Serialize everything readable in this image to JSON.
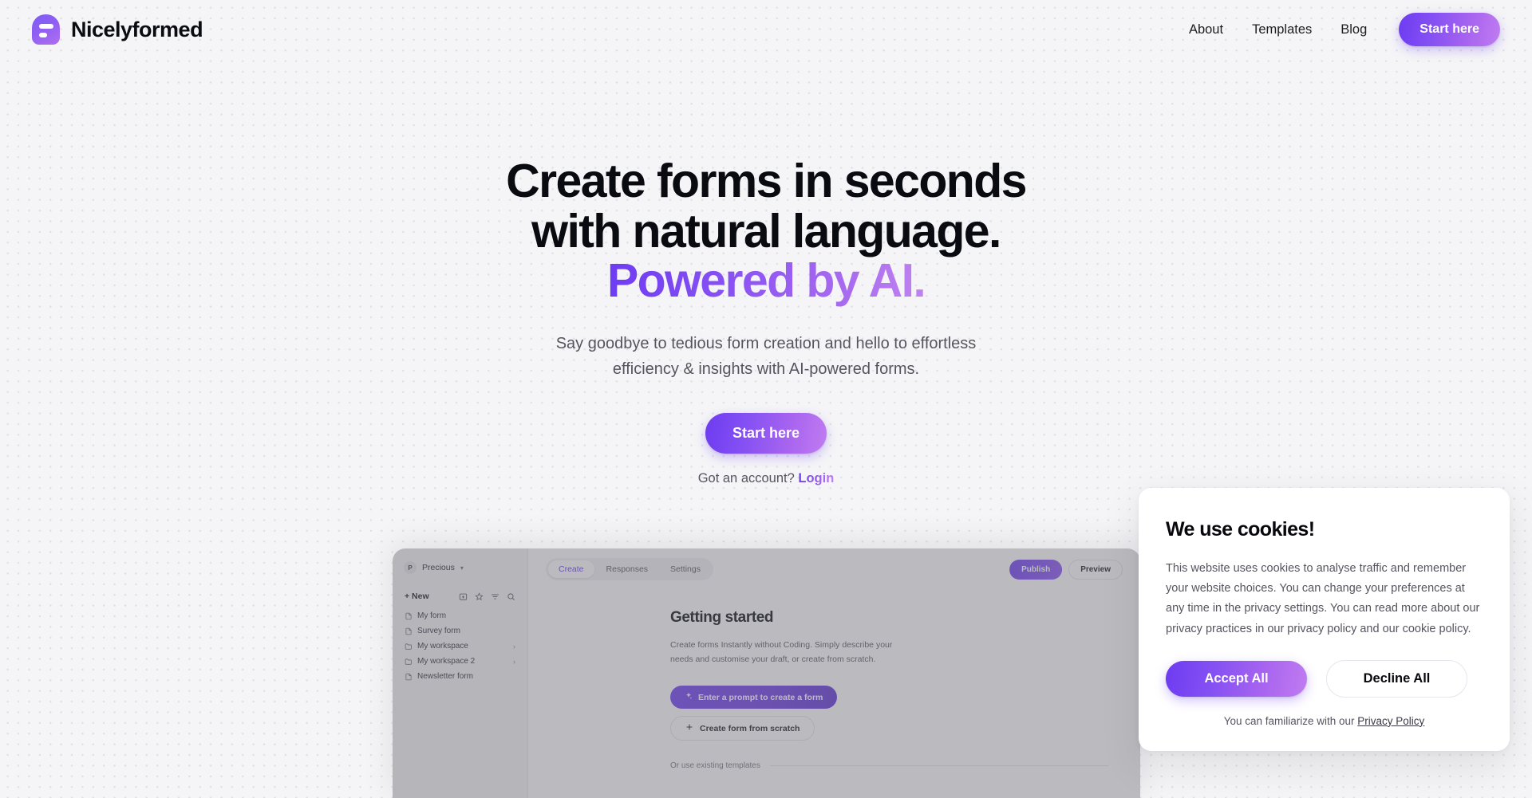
{
  "header": {
    "brand_name": "Nicelyformed",
    "nav": [
      {
        "label": "About"
      },
      {
        "label": "Templates"
      },
      {
        "label": "Blog"
      }
    ],
    "cta_label": "Start here"
  },
  "hero": {
    "title_line1": "Create forms in seconds",
    "title_line2": "with natural language.",
    "title_line3": "Powered by AI.",
    "subtitle": "Say goodbye to tedious form creation and hello to effortless efficiency & insights with AI-powered forms.",
    "cta_label": "Start here",
    "account_prefix": "Got an account? ",
    "login_label": "Login"
  },
  "mockup": {
    "sidebar": {
      "workspace_initial": "P",
      "workspace_name": "Precious",
      "new_label": "+ New",
      "tools": [
        {
          "name": "new-folder-icon"
        },
        {
          "name": "star-icon"
        },
        {
          "name": "filter-icon"
        },
        {
          "name": "search-icon"
        }
      ],
      "items": [
        {
          "label": "My form",
          "type": "file",
          "expandable": false
        },
        {
          "label": "Survey form",
          "type": "file",
          "expandable": false
        },
        {
          "label": "My workspace",
          "type": "folder",
          "expandable": true
        },
        {
          "label": "My workspace 2",
          "type": "folder",
          "expandable": true
        },
        {
          "label": "Newsletter form",
          "type": "file",
          "expandable": false
        }
      ]
    },
    "tabs": [
      {
        "label": "Create",
        "active": true
      },
      {
        "label": "Responses",
        "active": false
      },
      {
        "label": "Settings",
        "active": false
      }
    ],
    "publish_label": "Publish",
    "preview_label": "Preview",
    "heading": "Getting started",
    "description": "Create forms Instantly without Coding. Simply describe your needs and customise your draft, or create from scratch.",
    "prompt_button": "Enter a prompt to create a form",
    "scratch_button": "Create form from scratch",
    "templates_label": "Or use existing templates"
  },
  "cookie": {
    "title": "We use cookies!",
    "body": "This website uses cookies to analyse traffic and remember your website choices. You can change your preferences at any time in the privacy settings. You can read more about our privacy practices in our privacy policy and our cookie policy.",
    "accept_label": "Accept All",
    "decline_label": "Decline All",
    "footer_prefix": "You can familiarize with our ",
    "footer_link": "Privacy Policy"
  },
  "colors": {
    "brand_violet": "#6d3bf2",
    "brand_light_purple": "#c084f0",
    "page_bg": "#f5f5f7",
    "text_primary": "#0a0a11",
    "text_muted": "#55555f"
  }
}
